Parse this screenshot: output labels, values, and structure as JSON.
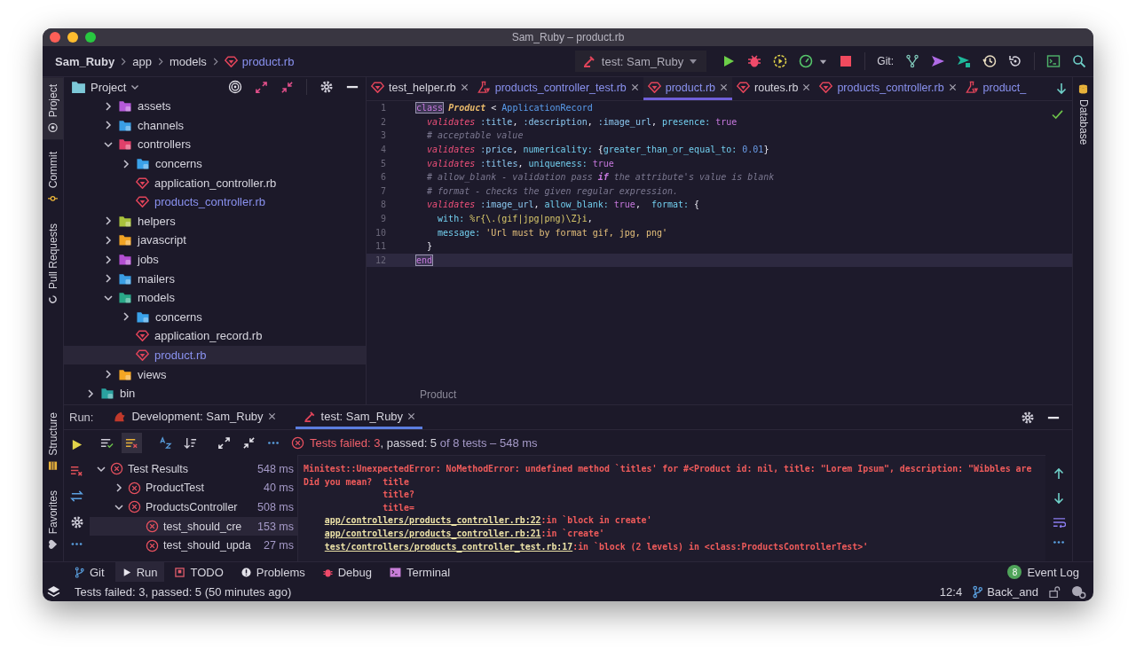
{
  "window": {
    "title": "Sam_Ruby – product.rb"
  },
  "breadcrumb": [
    {
      "label": "Sam_Ruby",
      "kind": "project"
    },
    {
      "label": "app",
      "kind": "folder"
    },
    {
      "label": "models",
      "kind": "folder"
    },
    {
      "label": "product.rb",
      "kind": "ruby"
    }
  ],
  "run_config": {
    "label": "test: Sam_Ruby"
  },
  "vcs_label": "Git:",
  "left_stripe": [
    {
      "label": "Project",
      "kind": "project",
      "selected": true
    },
    {
      "label": "Commit",
      "kind": "commit",
      "selected": false
    },
    {
      "label": "Pull Requests",
      "kind": "pull",
      "selected": false
    }
  ],
  "left_stripe_bottom": [
    {
      "label": "Structure",
      "kind": "structure"
    },
    {
      "label": "Favorites",
      "kind": "favorites"
    }
  ],
  "right_stripe": [
    {
      "label": "Database",
      "kind": "database"
    }
  ],
  "project_panel": {
    "title": "Project",
    "tree": [
      {
        "children": [
          {
            "name": "assets",
            "kind": "folder",
            "color": "#b45ad8",
            "expanded": false,
            "selected": false
          },
          {
            "name": "channels",
            "kind": "folder",
            "color": "#3a9ee4",
            "expanded": false,
            "selected": false
          },
          {
            "name": "controllers",
            "kind": "folder",
            "color": "#e0406a",
            "expanded": true,
            "selected": false,
            "children": [
              {
                "name": "concerns",
                "kind": "folder",
                "color": "#3aa2ea",
                "expanded": false,
                "selected": false
              },
              {
                "name": "application_controller.rb",
                "kind": "ruby",
                "changed": false,
                "selected": false
              },
              {
                "name": "products_controller.rb",
                "kind": "ruby",
                "changed": true,
                "selected": false
              }
            ]
          },
          {
            "name": "helpers",
            "kind": "folder",
            "color": "#a9c23c",
            "expanded": false,
            "selected": false
          },
          {
            "name": "javascript",
            "kind": "folder",
            "color": "#f0a324",
            "expanded": false,
            "selected": false
          },
          {
            "name": "jobs",
            "kind": "folder",
            "color": "#b24fd2",
            "expanded": false,
            "selected": false
          },
          {
            "name": "mailers",
            "kind": "folder",
            "color": "#3a9ee4",
            "expanded": false,
            "selected": false
          },
          {
            "name": "models",
            "kind": "folder",
            "color": "#2aa889",
            "expanded": true,
            "selected": false,
            "children": [
              {
                "name": "concerns",
                "kind": "folder",
                "color": "#3aa2ea",
                "expanded": false,
                "selected": false
              },
              {
                "name": "application_record.rb",
                "kind": "ruby",
                "changed": false,
                "selected": false
              },
              {
                "name": "product.rb",
                "kind": "ruby",
                "changed": true,
                "selected": true
              }
            ]
          },
          {
            "name": "views",
            "kind": "folder",
            "color": "#f5a623",
            "expanded": false,
            "selected": false
          }
        ]
      },
      {
        "name": "bin",
        "kind": "folder",
        "color": "#2aa3a0",
        "expanded": false,
        "selected": false
      }
    ]
  },
  "editor": {
    "tabs": [
      {
        "label": "test_helper.rb",
        "kind": "ruby",
        "changed": false,
        "selected": false,
        "closable": true
      },
      {
        "label": "products_controller_test.rb",
        "kind": "test",
        "changed": true,
        "selected": false,
        "closable": true
      },
      {
        "label": "product.rb",
        "kind": "ruby",
        "changed": true,
        "selected": true,
        "closable": true
      },
      {
        "label": "routes.rb",
        "kind": "ruby",
        "changed": false,
        "selected": false,
        "closable": true
      },
      {
        "label": "products_controller.rb",
        "kind": "ruby",
        "changed": true,
        "selected": false,
        "closable": true
      },
      {
        "label": "product_",
        "kind": "test",
        "changed": true,
        "selected": false,
        "closable": false
      }
    ],
    "lines": [
      {
        "number": "1",
        "current": false,
        "tokens": [
          {
            "t": "class",
            "kind": "match"
          },
          {
            "t": " Product",
            "kind": "cls"
          },
          {
            "t": " < ",
            "kind": "punct"
          },
          {
            "t": "ApplicationRecord",
            "kind": "const"
          }
        ]
      },
      {
        "number": "2",
        "current": false,
        "tokens": [
          {
            "t": "  validates",
            "kind": "method"
          },
          {
            "t": " :title",
            "kind": "sym"
          },
          {
            "t": ", ",
            "kind": "punct"
          },
          {
            "t": ":description",
            "kind": "sym"
          },
          {
            "t": ", ",
            "kind": "punct"
          },
          {
            "t": ":image_url",
            "kind": "sym"
          },
          {
            "t": ", ",
            "kind": "punct"
          },
          {
            "t": "presence:",
            "kind": "key"
          },
          {
            "t": " true",
            "kind": "bool"
          }
        ]
      },
      {
        "number": "3",
        "current": false,
        "tokens": [
          {
            "t": "  # acceptable value",
            "kind": "comment"
          }
        ]
      },
      {
        "number": "4",
        "current": false,
        "tokens": [
          {
            "t": "  validates",
            "kind": "method"
          },
          {
            "t": " :price",
            "kind": "sym"
          },
          {
            "t": ", ",
            "kind": "punct"
          },
          {
            "t": "numericality:",
            "kind": "key"
          },
          {
            "t": " {",
            "kind": "punct"
          },
          {
            "t": "greater_than_or_equal_to:",
            "kind": "key"
          },
          {
            "t": " 0.01",
            "kind": "num"
          },
          {
            "t": "}",
            "kind": "punct"
          }
        ]
      },
      {
        "number": "5",
        "current": false,
        "tokens": [
          {
            "t": "  validates",
            "kind": "method"
          },
          {
            "t": " :titles",
            "kind": "sym"
          },
          {
            "t": ", ",
            "kind": "punct"
          },
          {
            "t": "uniqueness:",
            "kind": "key"
          },
          {
            "t": " true",
            "kind": "bool"
          }
        ]
      },
      {
        "number": "6",
        "current": false,
        "tokens": [
          {
            "t": "  # allow_blank - validation pass ",
            "kind": "comment"
          },
          {
            "t": "if",
            "kind": "comment-kw"
          },
          {
            "t": " the attribute's value is blank",
            "kind": "comment"
          }
        ]
      },
      {
        "number": "7",
        "current": false,
        "tokens": [
          {
            "t": "  # format - checks the given regular expression.",
            "kind": "comment"
          }
        ]
      },
      {
        "number": "8",
        "current": false,
        "tokens": [
          {
            "t": "  validates",
            "kind": "method"
          },
          {
            "t": " :image_url",
            "kind": "sym"
          },
          {
            "t": ", ",
            "kind": "punct"
          },
          {
            "t": "allow_blank:",
            "kind": "key"
          },
          {
            "t": " true",
            "kind": "bool"
          },
          {
            "t": ",  ",
            "kind": "punct"
          },
          {
            "t": "format:",
            "kind": "key"
          },
          {
            "t": " {",
            "kind": "punct"
          }
        ]
      },
      {
        "number": "9",
        "current": false,
        "tokens": [
          {
            "t": "    with:",
            "kind": "key"
          },
          {
            "t": " %r{\\.(gif|jpg|png)\\Z}i",
            "kind": "regex"
          },
          {
            "t": ",",
            "kind": "punct"
          }
        ]
      },
      {
        "number": "10",
        "current": false,
        "tokens": [
          {
            "t": "    message:",
            "kind": "key"
          },
          {
            "t": " 'Url must by format gif, jpg, png'",
            "kind": "str"
          }
        ]
      },
      {
        "number": "11",
        "current": false,
        "tokens": [
          {
            "t": "  }",
            "kind": "punct"
          }
        ]
      },
      {
        "number": "12",
        "current": true,
        "tokens": [
          {
            "t": "end",
            "kind": "match"
          }
        ]
      }
    ],
    "footer": "Product"
  },
  "run_panel": {
    "label": "Run:",
    "tabs": [
      {
        "label": "Development: Sam_Ruby",
        "kind": "dev",
        "selected": false
      },
      {
        "label": "test: Sam_Ruby",
        "kind": "test",
        "selected": true
      }
    ],
    "summary": {
      "failed_label": "Tests failed:",
      "failed": "3",
      "passed": ", passed: 5",
      "rest": "of 8 tests – 548 ms"
    },
    "tests": [
      {
        "name": "Test Results",
        "time": "548 ms",
        "passed": false,
        "expanded": true,
        "selected": false,
        "children": [
          {
            "name": "ProductTest",
            "time": "40 ms",
            "passed": false,
            "expanded": false,
            "selected": false
          },
          {
            "name": "ProductsController",
            "time": "508 ms",
            "passed": false,
            "expanded": true,
            "selected": false,
            "children": [
              {
                "name": "test_should_cre",
                "time": "153 ms",
                "passed": false,
                "selected": true
              },
              {
                "name": "test_should_upda",
                "time": "27 ms",
                "passed": false,
                "selected": false
              }
            ]
          }
        ]
      }
    ],
    "output": [
      {
        "kind": "error",
        "text": "Minitest::UnexpectedError: NoMethodError: undefined method `titles' for #<Product id: nil, title: \"Lorem Ipsum\", description: \"Wibbles are"
      },
      {
        "kind": "error",
        "text": "Did you mean?  title"
      },
      {
        "kind": "error",
        "text": "               title?"
      },
      {
        "kind": "error",
        "text": "               title="
      },
      {
        "kind": "trace",
        "link": "app/controllers/products_controller.rb:22",
        "text": ":in `block in create'"
      },
      {
        "kind": "trace",
        "link": "app/controllers/products_controller.rb:21",
        "text": ":in `create'"
      },
      {
        "kind": "trace",
        "link": "test/controllers/products_controller_test.rb:17",
        "text": ":in `block (2 levels) in <class:ProductsControllerTest>'"
      }
    ]
  },
  "tool_tabs": [
    {
      "label": "Git",
      "kind": "git",
      "selected": false
    },
    {
      "label": "Run",
      "kind": "run",
      "selected": true
    },
    {
      "label": "TODO",
      "kind": "todo",
      "selected": false
    },
    {
      "label": "Problems",
      "kind": "problems",
      "selected": false
    },
    {
      "label": "Debug",
      "kind": "debug",
      "selected": false
    },
    {
      "label": "Terminal",
      "kind": "terminal",
      "selected": false
    }
  ],
  "event_log": {
    "label": "Event Log",
    "count": "8"
  },
  "status_bar": {
    "message": "Tests failed: 3, passed: 5 (50 minutes ago)",
    "position": "12:4",
    "branch": "Back_and"
  }
}
